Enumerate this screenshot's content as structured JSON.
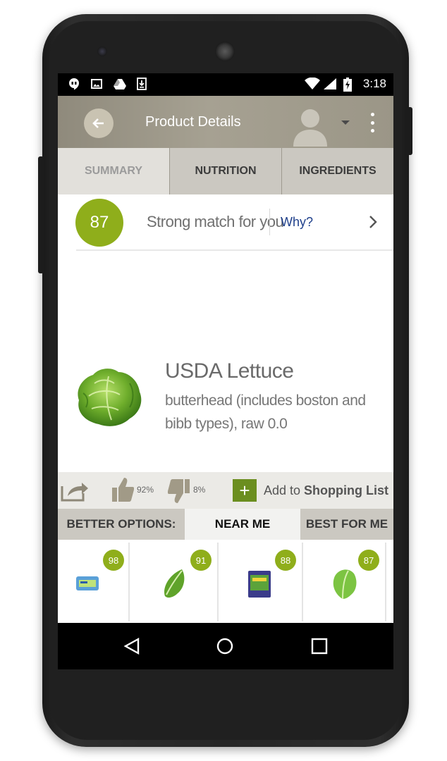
{
  "status_bar": {
    "time": "3:18",
    "left_icons": [
      "hangouts-icon",
      "image-icon",
      "drive-icon",
      "download-icon"
    ],
    "right_icons": [
      "wifi-icon",
      "signal-icon",
      "battery-charging-icon"
    ]
  },
  "app_bar": {
    "title": "Product Details",
    "back_icon": "back-arrow-icon",
    "avatar_icon": "user-avatar-icon",
    "menu_icon": "overflow-menu-icon"
  },
  "tabs": [
    {
      "label": "SUMMARY",
      "active": true
    },
    {
      "label": "NUTRITION",
      "active": false
    },
    {
      "label": "INGREDIENTS",
      "active": false
    }
  ],
  "match": {
    "score": "87",
    "text": "Strong match for you",
    "why_label": "Why?"
  },
  "product": {
    "name": "USDA Lettuce",
    "description": "butterhead (includes boston and bibb types), raw 0.0"
  },
  "actions": {
    "like_pct": "92%",
    "dislike_pct": "8%",
    "add_prefix": "Add to ",
    "add_bold": "Shopping List"
  },
  "options": {
    "label": "BETTER OPTIONS:",
    "near_me": "NEAR ME",
    "best_for_me": "BEST FOR ME"
  },
  "alternatives": [
    {
      "score": "98"
    },
    {
      "score": "91"
    },
    {
      "score": "88"
    },
    {
      "score": "87"
    }
  ],
  "colors": {
    "score_green": "#8fae1b",
    "link_blue": "#1e3f8b",
    "app_bar": "#a29d8e"
  }
}
